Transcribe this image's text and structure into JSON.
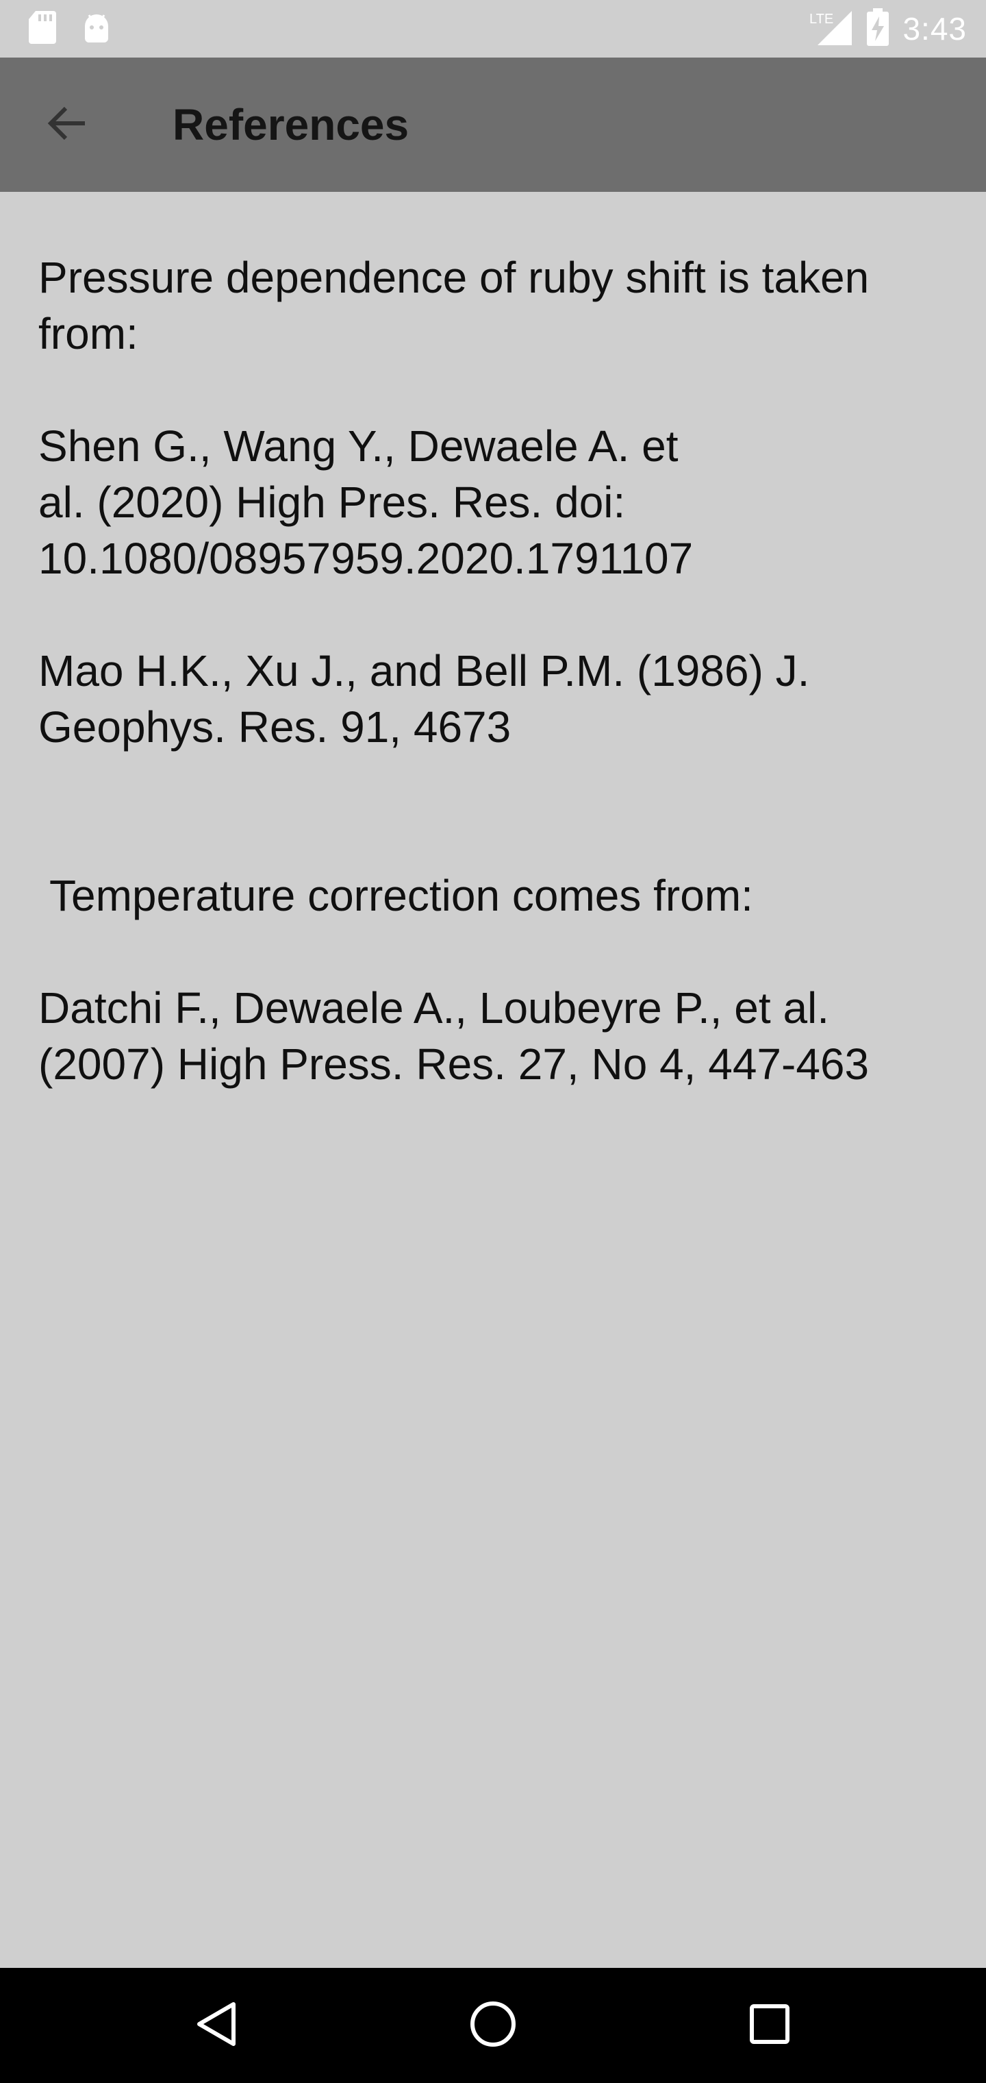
{
  "status_bar": {
    "left_icons": [
      "sd-card-icon",
      "android-icon"
    ],
    "network_label": "LTE",
    "time": "3:43"
  },
  "app_bar": {
    "title": "References",
    "back_icon": "arrow-back-icon"
  },
  "references": {
    "intro_pressure": "Pressure dependence of ruby shift is taken from:",
    "ref_shen": "Shen G., Wang Y., Dewaele A. et al. (2020) High Pres. Res. doi: 10.1080/08957959.2020.1791107",
    "ref_mao": "Mao H.K., Xu J., and Bell P.M. (1986) J. Geophys. Res. 91, 4673",
    "intro_temperature": "Temperature correction comes from:",
    "ref_datchi": "Datchi F., Dewaele A., Loubeyre P., et al. (2007) High Press. Res. 27, No 4, 447-463"
  },
  "nav_bar": {
    "back": "nav-back-icon",
    "home": "nav-home-icon",
    "recents": "nav-recents-icon"
  },
  "colors": {
    "background": "#cfcfcf",
    "app_bar": "#6e6e6e",
    "text": "#111111",
    "nav_bar": "#000000"
  }
}
